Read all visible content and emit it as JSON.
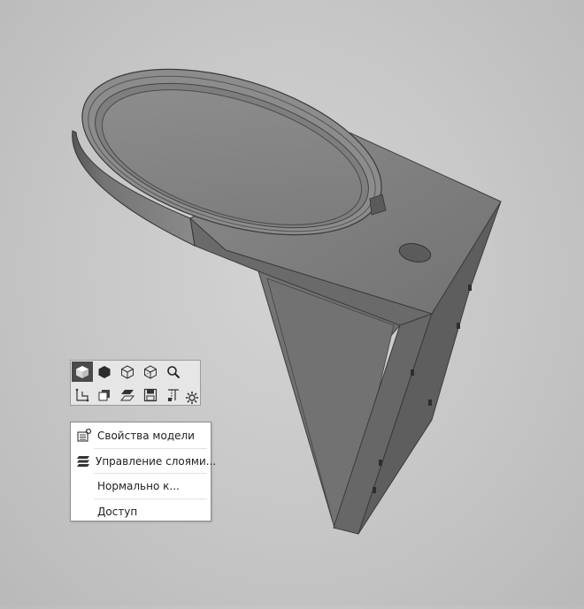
{
  "viewport": {
    "background_color": "#c8c8c8",
    "model_color": "#6e6e6e"
  },
  "mini_toolbar": {
    "row1": [
      {
        "icon": "view-orientation-cube-icon",
        "active": true
      },
      {
        "icon": "shaded-display-icon",
        "active": false
      },
      {
        "icon": "wireframe-display-icon",
        "active": false
      },
      {
        "icon": "hidden-lines-display-icon",
        "active": false
      },
      {
        "icon": "zoom-icon",
        "active": false
      }
    ],
    "row2": [
      {
        "icon": "sketch-icon"
      },
      {
        "icon": "section-view-icon"
      },
      {
        "icon": "plane-icon"
      },
      {
        "icon": "save-icon"
      },
      {
        "icon": "dimensions-icon"
      }
    ],
    "settings_icon": "gear-icon"
  },
  "context_menu": {
    "items": [
      {
        "label": "Свойства модели",
        "icon": "model-properties-icon"
      },
      {
        "label": "Управление слоями...",
        "icon": "layers-icon"
      },
      {
        "label": "Нормально к...",
        "icon": ""
      },
      {
        "label": "Доступ",
        "icon": ""
      }
    ]
  }
}
